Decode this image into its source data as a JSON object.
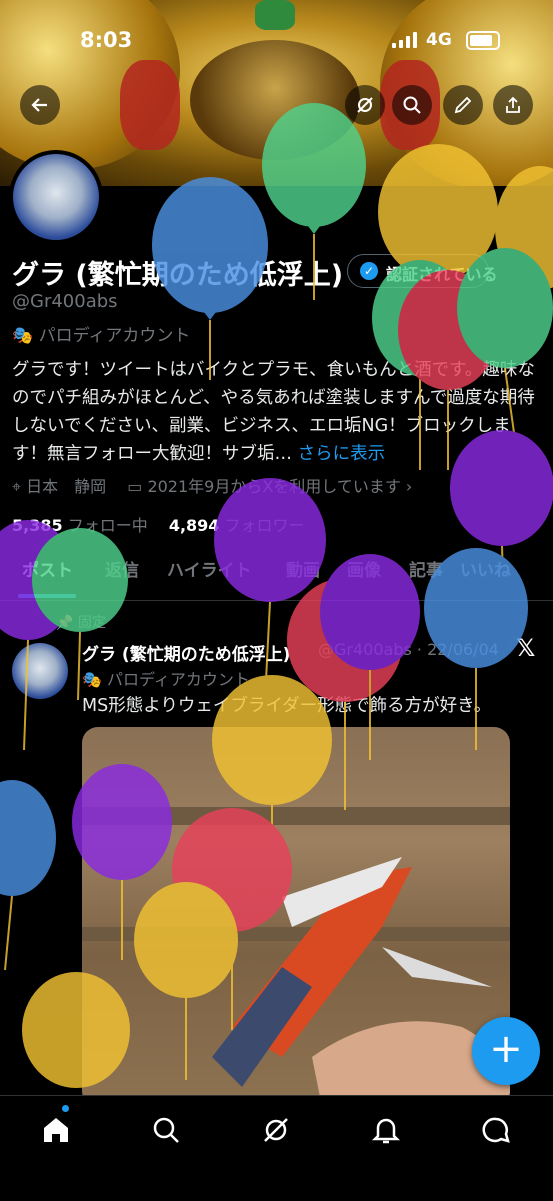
{
  "status_bar": {
    "time": "8:03",
    "network": "4G"
  },
  "header_buttons": {
    "back": "back-arrow-icon",
    "grok": "grok-icon",
    "search": "search-icon",
    "edit": "pencil-icon",
    "share": "share-icon"
  },
  "profile": {
    "display_name": "グラ (繁忙期のため低浮上)",
    "verify_label": "認証されている",
    "handle": "@Gr400abs",
    "parody_label": "パロディアカウント",
    "bio_text": "グラです！ツイートはバイクとプラモ、食いもんと酒です。趣味なのでパチ組みがほとんど、やる気あれば塗装しますんで過度な期待しないでください、副業、ビジネス、エロ垢NG！ブロックします！無言フォロー大歓迎！サブ垢…",
    "bio_more": "さらに表示",
    "location": "日本　静岡",
    "joined": "2021年9月からXを利用しています",
    "following_count": "5,385",
    "following_label": "フォロー中",
    "followers_count": "4,894",
    "followers_label": "フォロワー"
  },
  "tabs": [
    "ポスト",
    "返信",
    "ハイライト",
    "動画",
    "画像",
    "記事",
    "いいね"
  ],
  "pinned_post": {
    "pinned_label": "固定",
    "author_name": "グラ (繁忙期のため低浮上)",
    "author_handle": "@Gr400abs · 22/06/04",
    "parody_label": "パロディアカウント",
    "text": "MS形態よりウェイブライダー形態で飾る方が好き。"
  },
  "colors": {
    "accent": "#1d9bf0",
    "balloon_blue": "#4a90e2",
    "balloon_green": "#4fd18b",
    "balloon_yellow": "#f1c232",
    "balloon_red": "#e8415a",
    "balloon_purple": "#8a2be2"
  },
  "bottom_nav": [
    "home-icon",
    "search-icon",
    "grok-icon",
    "notifications-icon",
    "messages-icon"
  ]
}
